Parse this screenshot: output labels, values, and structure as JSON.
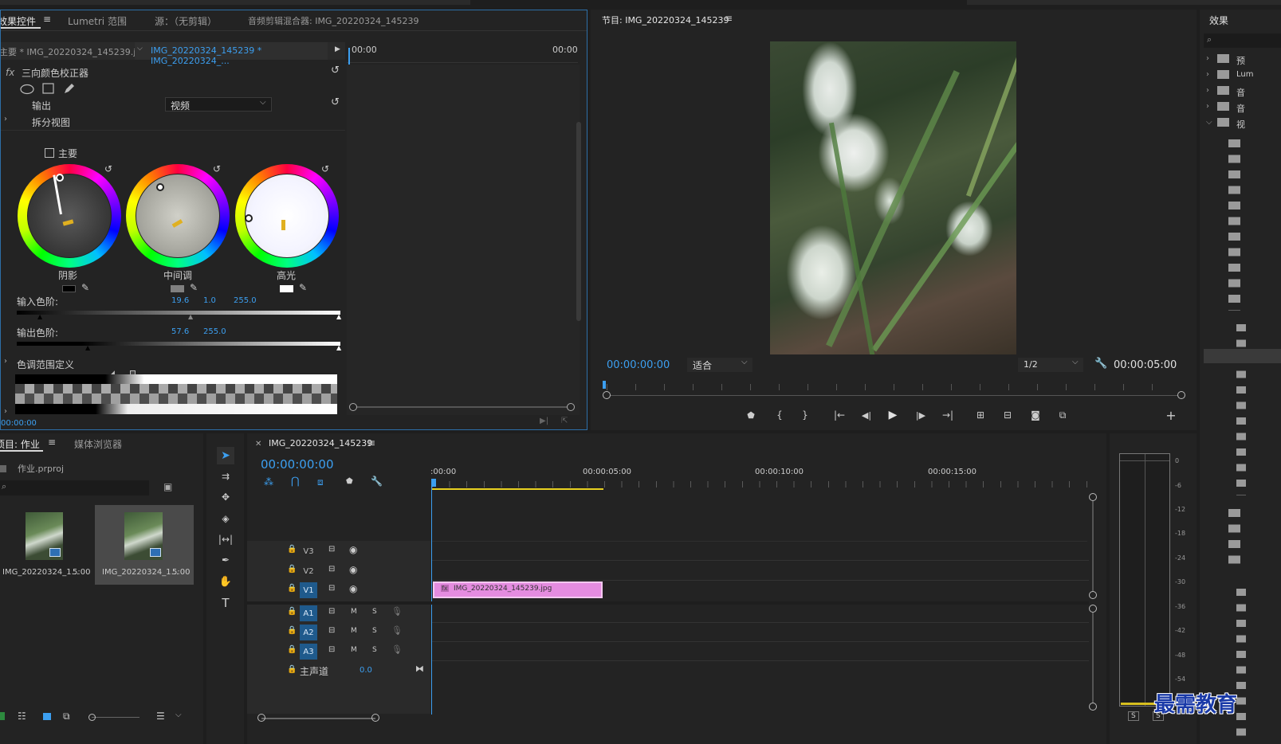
{
  "effect_controls": {
    "tabs": [
      "效果控件",
      "Lumetri 范围",
      "源：（无剪辑）",
      "音频剪辑混合器: IMG_20220324_145239"
    ],
    "source_clip": "主要 * IMG_20220324_145239.jpg",
    "sequence_clip": "IMG_20220324_145239 * IMG_20220324_...",
    "time_start": "00:00",
    "time_end": "00:00",
    "fx_label": "fx",
    "effect_name": "三向颜色校正器",
    "output_label": "输出",
    "output_value": "视频",
    "split_view_label": "拆分视图",
    "master_label": "主要",
    "wheels": [
      {
        "label": "阴影",
        "ring": "#000000"
      },
      {
        "label": "中间调",
        "ring": "#808080"
      },
      {
        "label": "高光",
        "ring": "#ffffff"
      }
    ],
    "input_levels_label": "输入色阶:",
    "input_levels": [
      "19.6",
      "1.0",
      "255.0"
    ],
    "output_levels_label": "输出色阶:",
    "output_levels": [
      "57.6",
      "255.0"
    ],
    "tonal_range_label": "色调范围定义",
    "bottom_time": "00:00:00"
  },
  "program_monitor": {
    "title": "节目: IMG_20220324_145239",
    "timecode": "00:00:00:00",
    "fit": "适合",
    "resolution": "1/2",
    "duration": "00:00:05:00"
  },
  "effects_panel": {
    "title": "效果",
    "folders": [
      "预",
      "Lum",
      "音",
      "音",
      "视"
    ]
  },
  "project": {
    "tabs": [
      "项目: 作业",
      "媒体浏览器"
    ],
    "file": "作业.prproj",
    "items": [
      {
        "name": "IMG_20220324_1...",
        "duration": "5:00"
      },
      {
        "name": "IMG_20220324_1...",
        "duration": "5:00"
      }
    ]
  },
  "timeline": {
    "title": "IMG_20220324_145239",
    "timecode": "00:00:00:00",
    "ruler": [
      ":00:00",
      "00:00:05:00",
      "00:00:10:00",
      "00:00:15:00"
    ],
    "video_tracks": [
      "V3",
      "V2",
      "V1"
    ],
    "audio_tracks": [
      "A1",
      "A2",
      "A3"
    ],
    "master_label": "主声道",
    "master_value": "0.0",
    "clip_name": "IMG_20220324_145239.jpg",
    "mute": "M",
    "solo": "S"
  },
  "meter": {
    "scale": [
      "0",
      "-6",
      "-12",
      "-18",
      "-24",
      "-30",
      "-36",
      "-42",
      "-48",
      "-54"
    ],
    "solo_labels": [
      "S",
      "S"
    ]
  },
  "watermark": "最需教育",
  "colors": {
    "accent": "#3c9ff0",
    "clip": "#e58ce0",
    "panel": "#232323",
    "bg": "#1e1e1e"
  }
}
